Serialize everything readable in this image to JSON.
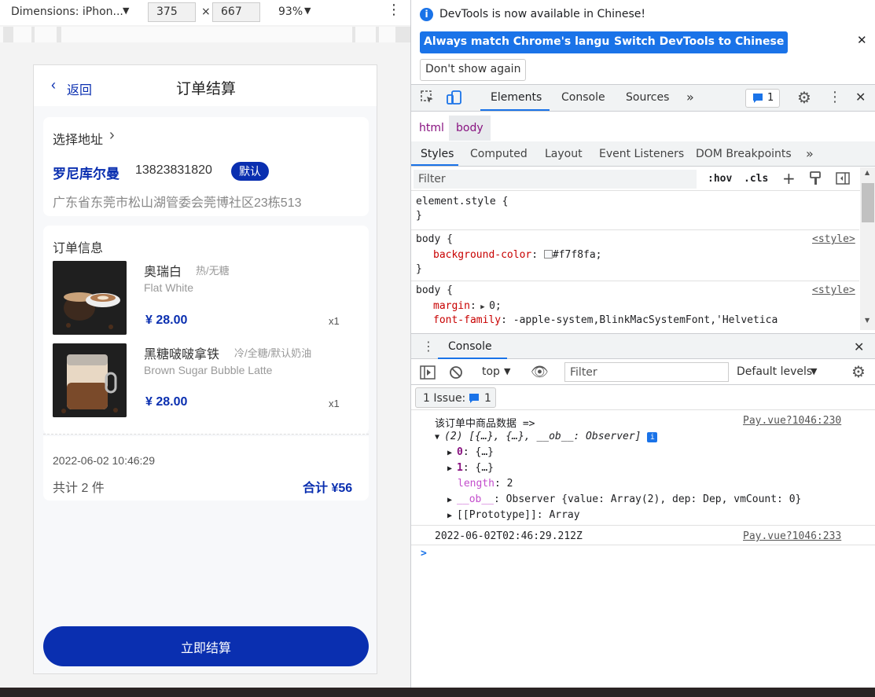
{
  "device_toolbar": {
    "dimensions_label": "Dimensions: iPhon...",
    "width": "375",
    "times": "×",
    "height": "667",
    "zoom": "93%"
  },
  "app": {
    "back_label": "返回",
    "page_title": "订单结算",
    "address": {
      "select_label": "选择地址",
      "name": "罗尼库尔曼",
      "phone": "13823831820",
      "default_badge": "默认",
      "detail": "广东省东莞市松山湖管委会莞博社区23栋513"
    },
    "order": {
      "section_title": "订单信息",
      "items": [
        {
          "name": "奥瑞白",
          "spec": "热/无糖",
          "en_name": "Flat White",
          "price": "¥ 28.00",
          "qty": "x1"
        },
        {
          "name": "黑糖啵啵拿铁",
          "spec": "冷/全糖/默认奶油",
          "en_name": "Brown Sugar Bubble Latte",
          "price": "¥ 28.00",
          "qty": "x1"
        }
      ],
      "time": "2022-06-02 10:46:29",
      "count_text": "共计 2 件",
      "total_text": "合计 ¥56"
    },
    "pay_button": "立即结算"
  },
  "devtools": {
    "info_text": "DevTools is now available in Chinese!",
    "btn_match": "Always match Chrome's language",
    "btn_switch": "Switch DevTools to Chinese",
    "btn_dont_show": "Don't show again",
    "tabs": [
      "Elements",
      "Console",
      "Sources"
    ],
    "issues_count": "1",
    "crumbs": [
      "html",
      "body"
    ],
    "subtabs": [
      "Styles",
      "Computed",
      "Layout",
      "Event Listeners",
      "DOM Breakpoints"
    ],
    "filter_placeholder": "Filter",
    "hov": ":hov",
    "cls": ".cls",
    "rules": {
      "element_style": "element.style {",
      "close": "}",
      "body1_selector": "body {",
      "body1_source": "<style>",
      "body1_prop": "background-color",
      "body1_value": "#f7f8fa;",
      "body2_selector": "body {",
      "body2_source": "<style>",
      "margin_prop": "margin",
      "margin_value": "0;",
      "font_prop": "font-family",
      "font_value": "-apple-system,BlinkMacSystemFont,'Helvetica"
    },
    "console": {
      "title": "Console",
      "context": "top",
      "filter_placeholder": "Filter",
      "levels": "Default levels",
      "issue_label": "1 Issue:",
      "issue_count": "1",
      "log1_text": "该订单中商品数据 =>",
      "log1_source": "Pay.vue?1046:230",
      "array_summary": "(2) [{…}, {…}, __ob__: Observer]",
      "row0_key": "0",
      "row0_val": "{…}",
      "row1_key": "1",
      "row1_val": "{…}",
      "length_key": "length",
      "length_val": "2",
      "ob_key": "__ob__",
      "ob_val": "Observer {value: Array(2), dep: Dep, vmCount: 0}",
      "proto_key": "[[Prototype]]",
      "proto_val": "Array",
      "log2_text": "2022-06-02T02:46:29.212Z",
      "log2_source": "Pay.vue?1046:233",
      "prompt": ">"
    }
  }
}
